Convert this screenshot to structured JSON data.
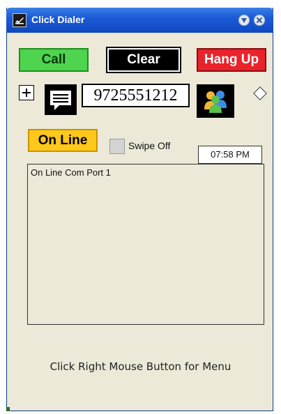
{
  "window": {
    "title": "Click Dialer"
  },
  "titlebar": {
    "icons": [
      "phone-icon",
      "pin-icon",
      "close-icon"
    ]
  },
  "buttons": {
    "call": "Call",
    "clear": "Clear",
    "hang_up": "Hang Up"
  },
  "colors": {
    "call": "#4ed44e",
    "hang_up": "#e9232b",
    "online": "#ffc81a",
    "title_bar": "#1c5ad6"
  },
  "dial": {
    "number": "9725551212"
  },
  "status": {
    "online_label": "On Line",
    "swipe_label": "Swipe Off",
    "time": "07:58 PM"
  },
  "log": {
    "lines": [
      "On Line Com Port 1"
    ]
  },
  "footer": {
    "hint": "Click Right Mouse Button for Menu"
  }
}
